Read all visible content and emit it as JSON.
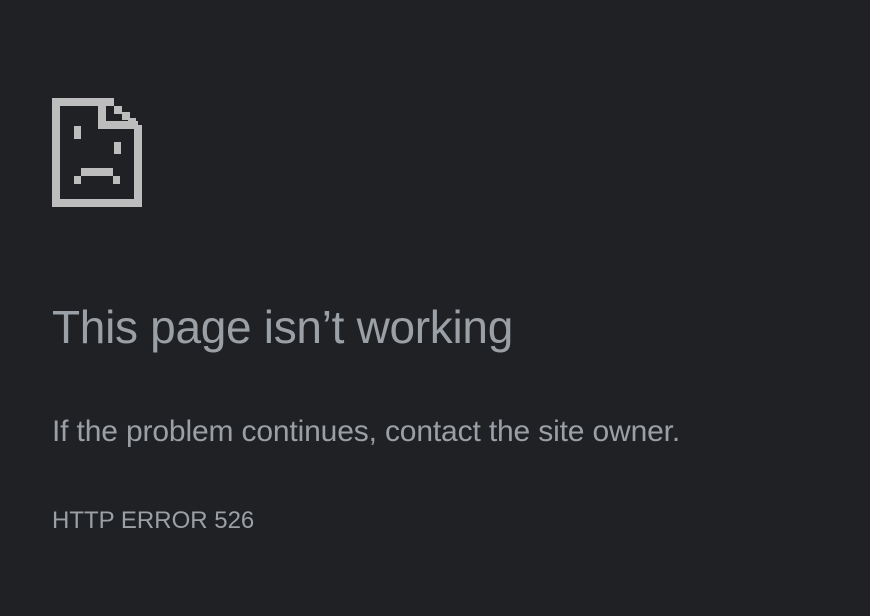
{
  "error_page": {
    "icon": "sad-page-icon",
    "title": "This page isn’t working",
    "message": "If the problem continues, contact the site owner.",
    "error_code": "HTTP ERROR 526"
  },
  "colors": {
    "background": "#202124",
    "text": "#9aa0a6",
    "icon": "#bdbdbd"
  }
}
